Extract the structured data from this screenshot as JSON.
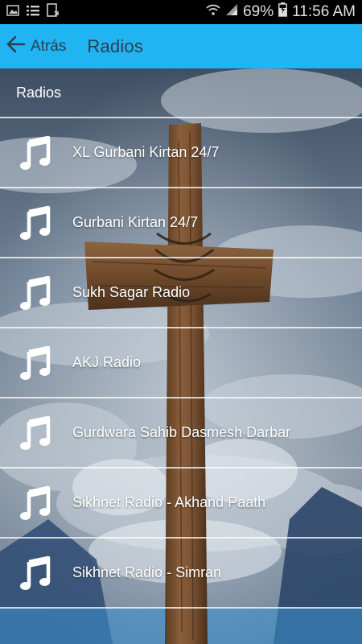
{
  "status_bar": {
    "battery": "69%",
    "time": "11:56 AM",
    "icons": [
      "image-icon",
      "list-icon",
      "download-icon",
      "wifi-icon",
      "signal-icon",
      "battery-icon"
    ]
  },
  "app_bar": {
    "back_label": "Atrás",
    "title": "Radios",
    "color": "#21b4f3"
  },
  "section": {
    "header": "Radios"
  },
  "radios": [
    {
      "label": "XL Gurbani Kirtan 24/7",
      "icon": "music-note-icon"
    },
    {
      "label": "Gurbani Kirtan 24/7",
      "icon": "music-note-icon"
    },
    {
      "label": "Sukh Sagar Radio",
      "icon": "music-note-icon"
    },
    {
      "label": "AKJ Radio",
      "icon": "music-note-icon"
    },
    {
      "label": "Gurdwara Sahib Dasmesh Darbar",
      "icon": "music-note-icon"
    },
    {
      "label": "Sikhnet Radio - Akhand Paath",
      "icon": "music-note-icon"
    },
    {
      "label": "Sikhnet Radio - Simran",
      "icon": "music-note-icon"
    }
  ]
}
